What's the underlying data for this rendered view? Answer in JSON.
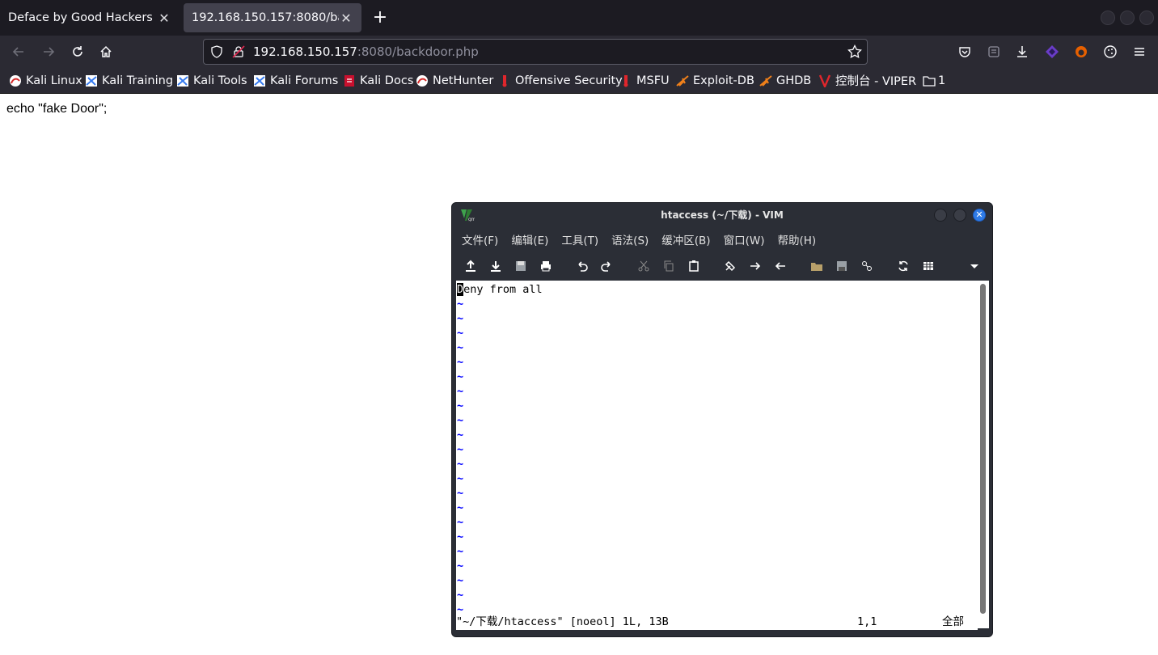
{
  "browser": {
    "tabs": [
      {
        "title": "Deface by Good Hackers",
        "active": false
      },
      {
        "title": "192.168.150.157:8080/backdoor.php",
        "active": true
      }
    ],
    "url": {
      "host": "192.168.150.157",
      "rest": ":8080/backdoor.php"
    },
    "bookmarks": [
      {
        "label": "Kali Linux",
        "icon": "kali-dragon-icon"
      },
      {
        "label": "Kali Training",
        "icon": "kali-training-icon"
      },
      {
        "label": "Kali Tools",
        "icon": "kali-tools-icon"
      },
      {
        "label": "Kali Forums",
        "icon": "kali-forums-icon"
      },
      {
        "label": "Kali Docs",
        "icon": "kali-docs-icon"
      },
      {
        "label": "NetHunter",
        "icon": "nethunter-icon"
      },
      {
        "label": "Offensive Security",
        "icon": "offsec-icon"
      },
      {
        "label": "MSFU",
        "icon": "msfu-icon"
      },
      {
        "label": "Exploit-DB",
        "icon": "exploit-db-icon"
      },
      {
        "label": "GHDB",
        "icon": "ghdb-icon"
      },
      {
        "label": "控制台 - VIPER",
        "icon": "viper-icon"
      },
      {
        "label": "1",
        "icon": "folder-icon"
      }
    ]
  },
  "page": {
    "content": "echo \"fake Door\";"
  },
  "vim": {
    "title": "htaccess (~/下载) - VIM",
    "menu": [
      "文件(F)",
      "编辑(E)",
      "工具(T)",
      "语法(S)",
      "缓冲区(B)",
      "窗口(W)",
      "帮助(H)"
    ],
    "buffer_first_char": "D",
    "buffer_rest": "eny from all",
    "tilde": "~",
    "status_file": "\"~/下载/htaccess\" [noeol] 1L, 13B",
    "status_pos": "1,1",
    "status_scroll": "全部"
  },
  "colors": {
    "chrome_dark": "#1c1b22",
    "chrome": "#2b2a33",
    "vim_bg": "#2b2e36",
    "tilde_blue": "#0000ff",
    "close_blue": "#2f7be6"
  }
}
